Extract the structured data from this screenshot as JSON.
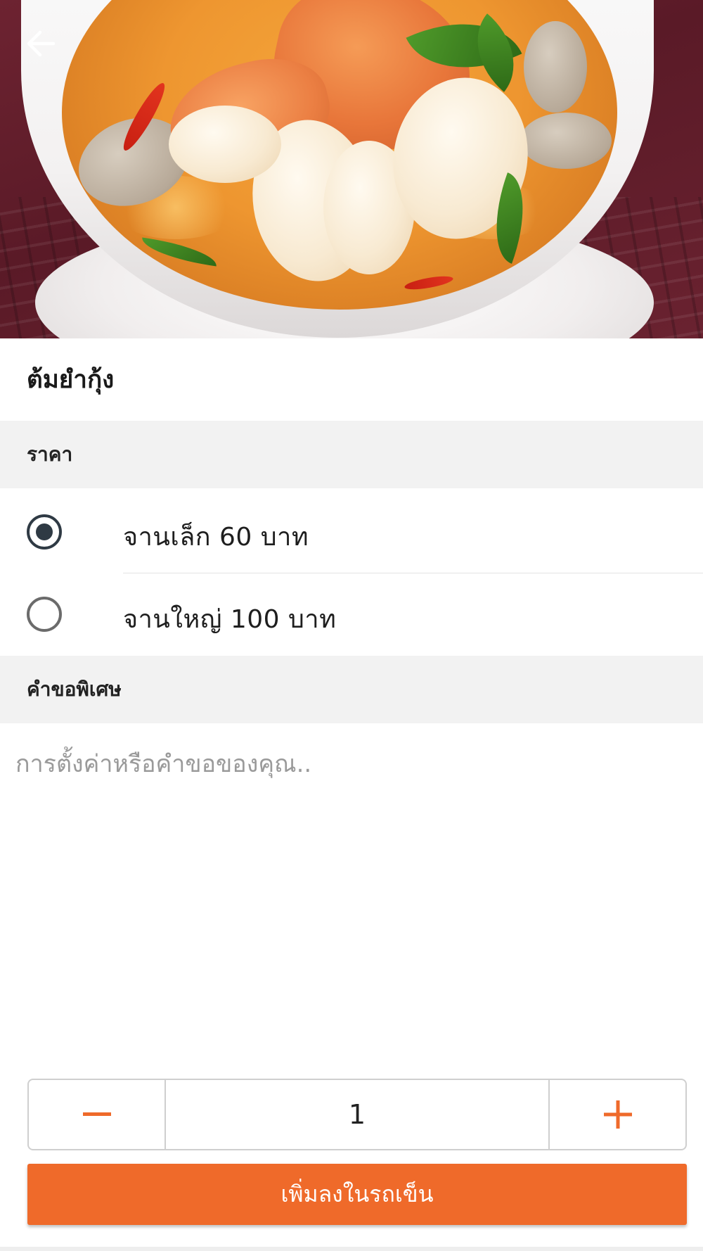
{
  "dish": {
    "name": "ต้มยำกุ้ง",
    "image_icon": "dish-photo"
  },
  "navigation": {
    "back_icon": "arrow-left-icon"
  },
  "price_section": {
    "title": "ราคา",
    "options": [
      {
        "label": "จานเล็ก 60 บาท",
        "selected": true
      },
      {
        "label": "จานใหญ่ 100 บาท",
        "selected": false
      }
    ]
  },
  "special_request": {
    "title": "คำขอพิเศษ",
    "placeholder": "การตั้งค่าหรือคำขอของคุณ..",
    "value": ""
  },
  "quantity": {
    "value": "1",
    "minus_icon": "minus-icon",
    "plus_icon": "plus-icon"
  },
  "cart": {
    "add_label": "เพิ่มลงในรถเข็น"
  },
  "colors": {
    "accent": "#ef6a2a",
    "radio_selected": "#2f3a44",
    "section_bg": "#f2f2f2"
  }
}
